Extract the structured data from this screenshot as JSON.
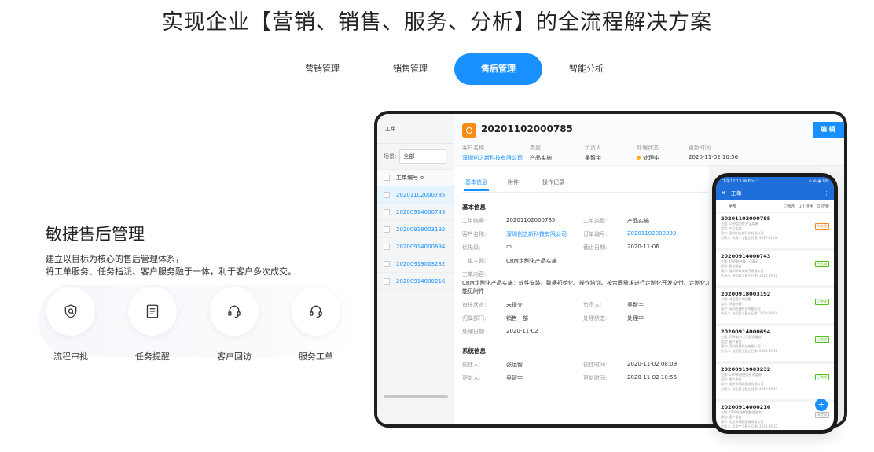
{
  "hero": {
    "title": "实现企业【营销、销售、服务、分析】的全流程解决方案"
  },
  "tabs": [
    {
      "label": "营销管理"
    },
    {
      "label": "销售管理"
    },
    {
      "label": "售后管理"
    },
    {
      "label": "智能分析"
    }
  ],
  "section": {
    "title": "敏捷售后管理",
    "desc_line1": "建立以目标为核心的售后管理体系，",
    "desc_line2": "将工单服务、任务指派、客户服务融于一体，利于客户多次成交。",
    "features": [
      {
        "label": "流程审批",
        "icon": "shield-icon"
      },
      {
        "label": "任务提醒",
        "icon": "document-icon"
      },
      {
        "label": "客户回访",
        "icon": "headset-icon"
      },
      {
        "label": "服务工单",
        "icon": "headset-icon"
      }
    ]
  },
  "tablet": {
    "list": {
      "title": "工单",
      "filter_label": "场景:",
      "filter_value": "全部",
      "column": "工单编号 ≎",
      "rows": [
        "20201102000785",
        "20200914000743",
        "20200918003192",
        "20200914000694",
        "20200919003232",
        "20200914000216"
      ]
    },
    "detail": {
      "number": "20201102000785",
      "edit": "编 辑",
      "meta": [
        {
          "k": "客户名称",
          "v": "深圳创之新科技有限公司"
        },
        {
          "k": "类型",
          "v": "产品实施"
        },
        {
          "k": "负责人",
          "v": "吴智宇"
        },
        {
          "k": "处理状态",
          "v": "处理中"
        },
        {
          "k": "更新时间",
          "v": "2020-11-02 10:56"
        }
      ],
      "tabs": [
        "基本信息",
        "附件",
        "操作记录"
      ],
      "basic_title": "基本信息",
      "fields": {
        "no_k": "工单编号:",
        "no_v": "20201102000785",
        "type_k": "工单类型:",
        "type_v": "产品实施",
        "cust_k": "客户名称:",
        "cust_v": "深圳创之新科技有限公司",
        "order_k": "订单编号:",
        "order_v": "20201102000393",
        "pri_k": "优先级:",
        "pri_v": "中",
        "due_k": "截止日期:",
        "due_v": "2020-11-06",
        "subj_k": "工单主题:",
        "subj_v": "CRM定制化产品实施",
        "content_k": "工单内容:",
        "content_v": "CRM定制化产品实施：软件安装、数据初始化、操作培训、按合同需求进行定制化开发交付。定制化功能见附件",
        "audit_k": "审核状态:",
        "audit_v": "未提交",
        "owner_k": "负责人:",
        "owner_v": "吴智宇",
        "dept_k": "归属部门:",
        "dept_v": "销售一部",
        "status_k": "处理状态:",
        "status_v": "处理中",
        "date_k": "处理日期:",
        "date_v": "2020-11-02"
      },
      "system_title": "系统信息",
      "system": {
        "creator_k": "创建人:",
        "creator_v": "张远智",
        "ctime_k": "创建时间:",
        "ctime_v": "2020-11-02 08:09",
        "updater_k": "更新人:",
        "updater_v": "吴智宇",
        "utime_k": "更新时间:",
        "utime_v": "2020-11-02 10:56"
      }
    }
  },
  "phone": {
    "status_left": "下午12:13 0KB/s ♡",
    "status_right": "⊙ ⊕ ▣ 88",
    "title": "工单",
    "filter_all": "全部",
    "ops": [
      "▽筛选",
      "↓↑排序",
      "Q 搜索"
    ],
    "cards": [
      {
        "no": "20201102000785",
        "l1": "主题: CRM定制化产品实施",
        "l2": "类型: 产品实施",
        "l3": "客户: 深圳创之新科技有限公司",
        "l4": "负责人: 吴智宇 | 截止日期: 2020-11-06",
        "tag": "待处理",
        "tone": "orange"
      },
      {
        "no": "20200914000743",
        "l1": "主题: CRM软件线上门演示",
        "l2": "类型: 售前服务",
        "l3": "客户: 深圳市联城电子有限公司",
        "l4": "负责人: 张远智 | 截止日期: 2020-09-18",
        "tag": "已完成",
        "tone": "green"
      },
      {
        "no": "20200918003192",
        "l1": "主题: 对接客户的问题",
        "l2": "类型: 问题处理",
        "l3": "客户: 深圳迅捷科技有限公司",
        "l4": "负责人: 张远智 | 截止日期: 2020-09-19",
        "tag": "已完成",
        "tone": "green"
      },
      {
        "no": "20200914000694",
        "l1": "主题: CRM软件上门培训服务",
        "l2": "类型: 客户服务",
        "l3": "客户: 深圳友量科技有限公司",
        "l4": "负责人: 张远智 | 截止日期: 2020-09-15",
        "tag": "已完成",
        "tone": "green"
      },
      {
        "no": "20200919003232",
        "l1": "主题: CRM系统使用技术咨询",
        "l2": "类型: 客户服务",
        "l3": "客户: 北京市锦绣家具有限公司",
        "l4": "负责人: 张远智 | 截止日期: 2020-09-19",
        "tag": "已完成",
        "tone": "green"
      },
      {
        "no": "20200914000216",
        "l1": "主题: CRM系统数据整理咨询",
        "l2": "类型: 客户服务",
        "l3": "客户: 北京市锦绣家具有限公司",
        "l4": "负责人: 吴智宇 | 截止日期: 2020-09-22",
        "tag": "未完成",
        "tone": "gray"
      }
    ],
    "fab": "+"
  },
  "colors": {
    "accent": "#1890ff",
    "orange": "#fa8c16",
    "green": "#52c41a"
  }
}
